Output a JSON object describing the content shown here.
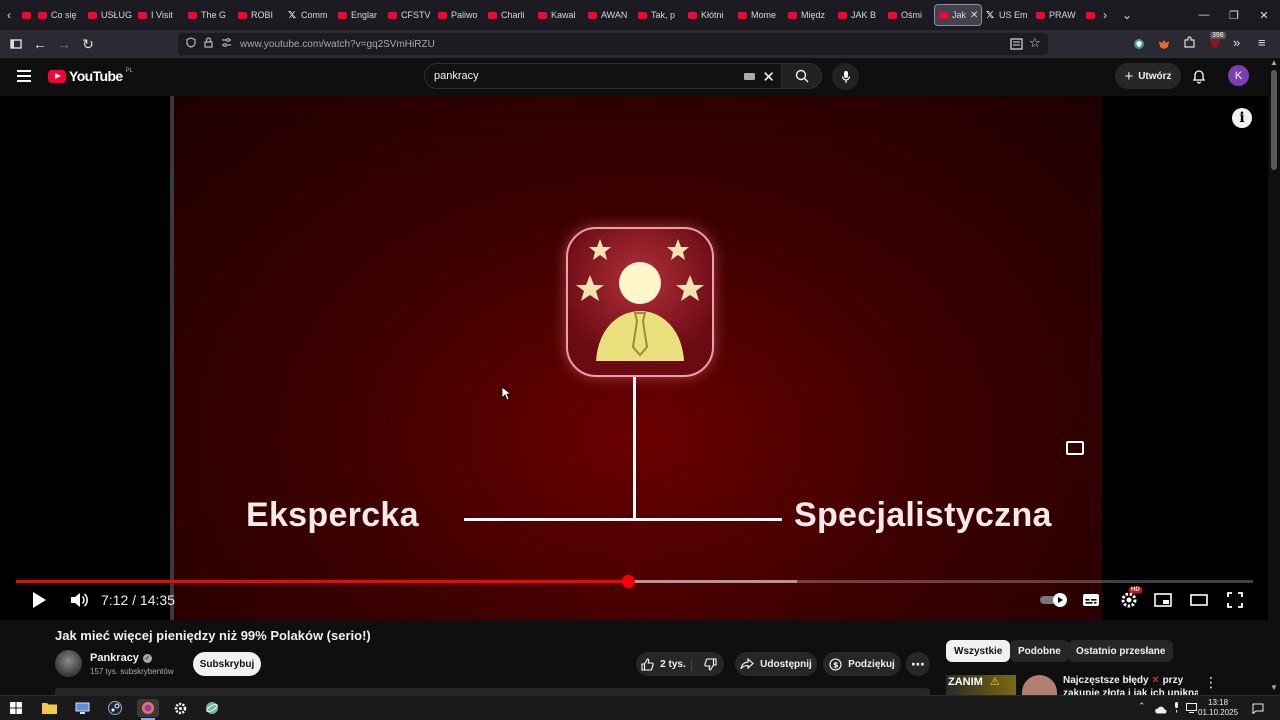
{
  "browser": {
    "tabs": [
      {
        "label": "",
        "fav": "yt",
        "w": 16
      },
      {
        "label": "Co się",
        "fav": "yt"
      },
      {
        "label": "USŁUG",
        "fav": "yt"
      },
      {
        "label": "I Visit",
        "fav": "yt"
      },
      {
        "label": "The G",
        "fav": "yt"
      },
      {
        "label": "ROBI",
        "fav": "yt"
      },
      {
        "label": "Comm",
        "fav": "x"
      },
      {
        "label": "Englar",
        "fav": "yt"
      },
      {
        "label": "CFSTV",
        "fav": "yt"
      },
      {
        "label": "Paliwo",
        "fav": "yt"
      },
      {
        "label": "Charli",
        "fav": "yt"
      },
      {
        "label": "Kawal",
        "fav": "yt"
      },
      {
        "label": "AWAN",
        "fav": "yt"
      },
      {
        "label": "Tak, p",
        "fav": "yt"
      },
      {
        "label": "Kłótni",
        "fav": "yt"
      },
      {
        "label": "Mome",
        "fav": "yt"
      },
      {
        "label": "Międz",
        "fav": "yt"
      },
      {
        "label": "JAK B",
        "fav": "yt"
      },
      {
        "label": "Ośmi",
        "fav": "yt"
      },
      {
        "label": "Jak",
        "fav": "yt",
        "active": true
      },
      {
        "label": "US Em",
        "fav": "x"
      },
      {
        "label": "PRAW",
        "fav": "yt"
      },
      {
        "label": "",
        "fav": "yt",
        "w": 14
      }
    ],
    "url": "www.youtube.com/watch?v=gq2SVmHiRZU",
    "extension_badge": "398"
  },
  "youtube": {
    "logo_text": "YouTube",
    "logo_country": "PL",
    "search_value": "pankracy",
    "create_label": "Utwórz",
    "avatar_letter": "K"
  },
  "player": {
    "video_left_label": "Ekspercka",
    "video_right_label": "Specjalistyczna",
    "time_text": "7:12 / 14:35",
    "played_fraction": 0.495,
    "buffered_fraction": 0.631,
    "accent": "#ff0000",
    "hd_badge": "HD"
  },
  "video_info": {
    "title": "Jak mieć więcej pieniędzy niż 99% Polaków (serio!)",
    "channel_name": "Pankracy",
    "subscribers": "157 tys. subskrybentów",
    "subscribe_label": "Subskrybuj",
    "likes": "2 tys.",
    "share_label": "Udostępnij",
    "thanks_label": "Podziękuj"
  },
  "recommendations": {
    "chips": [
      "Wszystkie",
      "Podobne",
      "Ostatnio przesłane"
    ],
    "first_thumb_text": "ZANIM",
    "first_title_a": "Najczęstsze błędy",
    "first_title_b": "przy",
    "first_title_line2": "zakupie złota i jak ich uniknąć"
  },
  "taskbar": {
    "time": "13:18",
    "date": "01.10.2025"
  }
}
